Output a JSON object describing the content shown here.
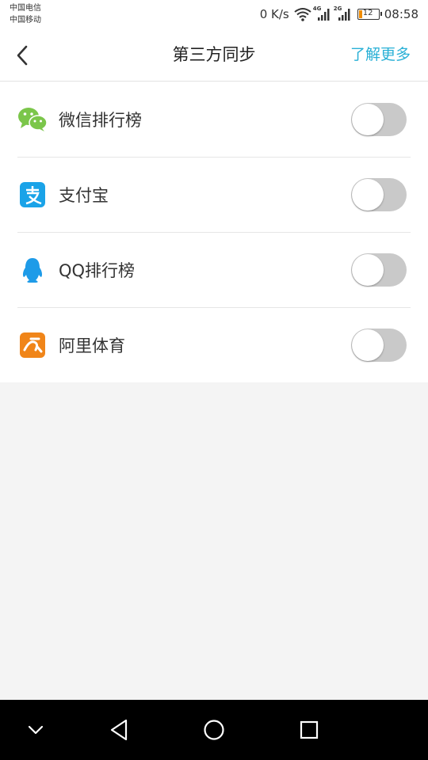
{
  "status_bar": {
    "carrier_1": "中国电信",
    "carrier_2": "中国移动",
    "net_speed": "0 K/s",
    "net_label_1": "4G",
    "net_label_2": "2G",
    "battery_level": "12",
    "time": "08:58"
  },
  "header": {
    "title": "第三方同步",
    "learn_more": "了解更多"
  },
  "items": [
    {
      "label": "微信排行榜",
      "icon": "wechat-icon",
      "enabled": false,
      "color": "#7bc64a"
    },
    {
      "label": "支付宝",
      "icon": "alipay-icon",
      "enabled": false,
      "color": "#1aa3e8"
    },
    {
      "label": "QQ排行榜",
      "icon": "qq-icon",
      "enabled": false,
      "color": "#1e9be8"
    },
    {
      "label": "阿里体育",
      "icon": "ali-sports-icon",
      "enabled": false,
      "color": "#f08519"
    }
  ],
  "nav": {
    "buttons": [
      "collapse-icon",
      "back-triangle-icon",
      "home-circle-icon",
      "recents-square-icon"
    ]
  },
  "colors": {
    "accent": "#29b0d6",
    "toggle_off": "#c9c9c9",
    "background": "#f4f4f4"
  }
}
